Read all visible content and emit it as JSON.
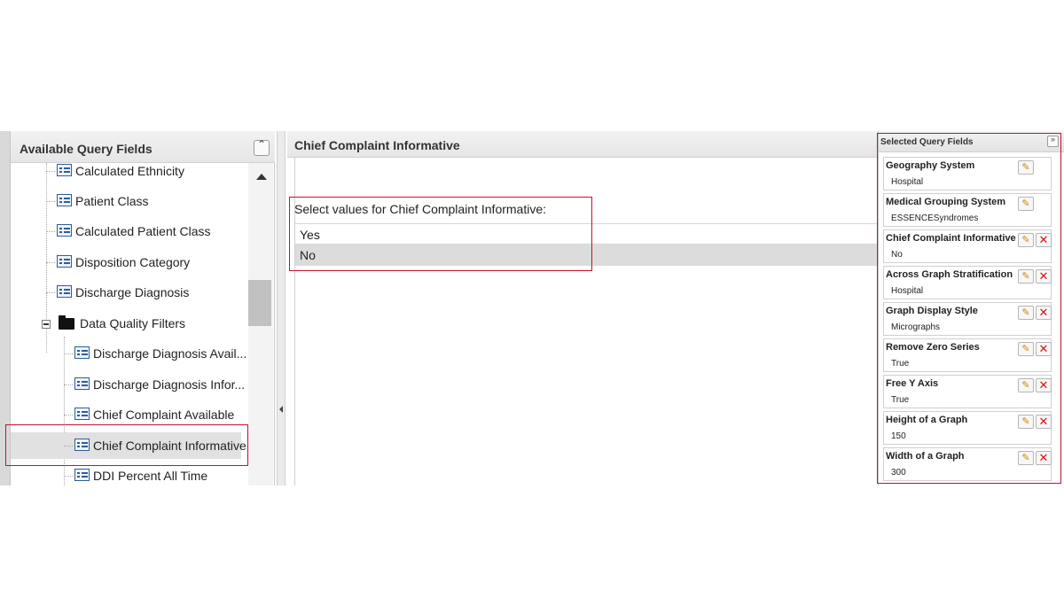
{
  "left_panel": {
    "title": "Available Query Fields",
    "collapse_icon": "double-chevron-up-icon",
    "items": [
      {
        "label": "Calculated Ethnicity",
        "type": "field"
      },
      {
        "label": "Patient Class",
        "type": "field"
      },
      {
        "label": "Calculated Patient Class",
        "type": "field"
      },
      {
        "label": "Disposition Category",
        "type": "field"
      },
      {
        "label": "Discharge Diagnosis",
        "type": "field"
      },
      {
        "label": "Data Quality Filters",
        "type": "folder"
      },
      {
        "label": "Discharge Diagnosis Avail...",
        "type": "field"
      },
      {
        "label": "Discharge Diagnosis Infor...",
        "type": "field"
      },
      {
        "label": "Chief Complaint Available",
        "type": "field"
      },
      {
        "label": "Chief Complaint Informative",
        "type": "field",
        "selected": true
      },
      {
        "label": "DDI Percent All Time",
        "type": "field"
      }
    ]
  },
  "center_panel": {
    "title": "Chief Complaint Informative",
    "prompt": "Select values for Chief Complaint Informative:",
    "values": [
      {
        "label": "Yes",
        "selected": false
      },
      {
        "label": "No",
        "selected": true
      }
    ]
  },
  "right_panel": {
    "title": "Selected Query Fields",
    "expand_icon": "double-chevron-right-icon",
    "cards": [
      {
        "title": "Geography System",
        "value": "Hospital",
        "removable": false
      },
      {
        "title": "Medical Grouping System",
        "value": "ESSENCESyndromes",
        "removable": false
      },
      {
        "title": "Chief Complaint Informative",
        "value": "No",
        "removable": true
      },
      {
        "title": "Across Graph Stratification",
        "value": "Hospital",
        "removable": true
      },
      {
        "title": "Graph Display Style",
        "value": "Micrographs",
        "removable": true
      },
      {
        "title": "Remove Zero Series",
        "value": "True",
        "removable": true
      },
      {
        "title": "Free Y Axis",
        "value": "True",
        "removable": true
      },
      {
        "title": "Height of a Graph",
        "value": "150",
        "removable": true
      },
      {
        "title": "Width of a Graph",
        "value": "300",
        "removable": true
      }
    ]
  },
  "colors": {
    "highlight": "#c8102e",
    "selected_row": "#dcdcdc",
    "icon_blue": "#2f5d9c",
    "delete_red": "#e01010",
    "edit_orange": "#c98a00"
  }
}
